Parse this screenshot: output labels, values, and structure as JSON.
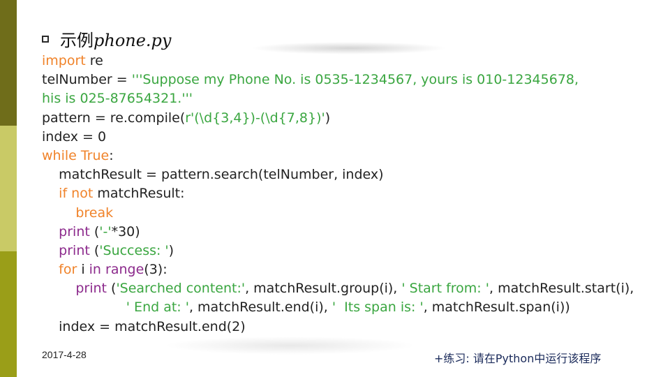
{
  "slide": {
    "title_cn": "示例",
    "title_code": "phone.py",
    "date": "2017-4-28",
    "exercise": "+练习: 请在Python中运行该程序"
  },
  "code_lines": [
    [
      {
        "t": "import",
        "c": "kw-o"
      },
      {
        "t": " re",
        "c": "plain"
      }
    ],
    [
      {
        "t": "telNumber = ",
        "c": "plain"
      },
      {
        "t": "'''Suppose my Phone No. is 0535-1234567, yours is 010-12345678,",
        "c": "str"
      }
    ],
    [
      {
        "t": "his is 025-87654321.'''",
        "c": "str"
      }
    ],
    [
      {
        "t": "pattern = re.compile(",
        "c": "plain"
      },
      {
        "t": "r'(\\d{3,4})-(\\d{7,8})'",
        "c": "str"
      },
      {
        "t": ")",
        "c": "plain"
      }
    ],
    [
      {
        "t": "index = 0",
        "c": "plain"
      }
    ],
    [
      {
        "t": "while True",
        "c": "kw-o"
      },
      {
        "t": ":",
        "c": "plain"
      }
    ],
    [
      {
        "t": "    matchResult = pattern.search(telNumber, index)",
        "c": "plain"
      }
    ],
    [
      {
        "t": "    ",
        "c": "plain"
      },
      {
        "t": "if not",
        "c": "kw-o"
      },
      {
        "t": " matchResult:",
        "c": "plain"
      }
    ],
    [
      {
        "t": "        ",
        "c": "plain"
      },
      {
        "t": "break",
        "c": "kw-o"
      }
    ],
    [
      {
        "t": "    ",
        "c": "plain"
      },
      {
        "t": "print",
        "c": "kw-p"
      },
      {
        "t": " (",
        "c": "plain"
      },
      {
        "t": "'-'",
        "c": "str"
      },
      {
        "t": "*30)",
        "c": "plain"
      }
    ],
    [
      {
        "t": "    ",
        "c": "plain"
      },
      {
        "t": "print",
        "c": "kw-p"
      },
      {
        "t": " (",
        "c": "plain"
      },
      {
        "t": "'Success: '",
        "c": "str"
      },
      {
        "t": ")",
        "c": "plain"
      }
    ],
    [
      {
        "t": "    ",
        "c": "plain"
      },
      {
        "t": "for",
        "c": "kw-o"
      },
      {
        "t": " i ",
        "c": "plain"
      },
      {
        "t": "in",
        "c": "kw-p"
      },
      {
        "t": " ",
        "c": "plain"
      },
      {
        "t": "range",
        "c": "kw-p"
      },
      {
        "t": "(3):",
        "c": "plain"
      }
    ],
    [
      {
        "t": "        ",
        "c": "plain"
      },
      {
        "t": "print",
        "c": "kw-p"
      },
      {
        "t": " (",
        "c": "plain"
      },
      {
        "t": "'Searched content:'",
        "c": "str"
      },
      {
        "t": ", matchResult.group(i), ",
        "c": "plain"
      },
      {
        "t": "' Start from: '",
        "c": "str"
      },
      {
        "t": ", matchResult.start(i),",
        "c": "plain"
      }
    ],
    [
      {
        "t": "                    ",
        "c": "plain"
      },
      {
        "t": "' End at: '",
        "c": "str"
      },
      {
        "t": ", matchResult.end(i), ",
        "c": "plain"
      },
      {
        "t": "'  Its span is: '",
        "c": "str"
      },
      {
        "t": ", matchResult.span(i))",
        "c": "plain"
      }
    ],
    [
      {
        "t": "    index = matchResult.end(2)",
        "c": "plain"
      }
    ]
  ]
}
